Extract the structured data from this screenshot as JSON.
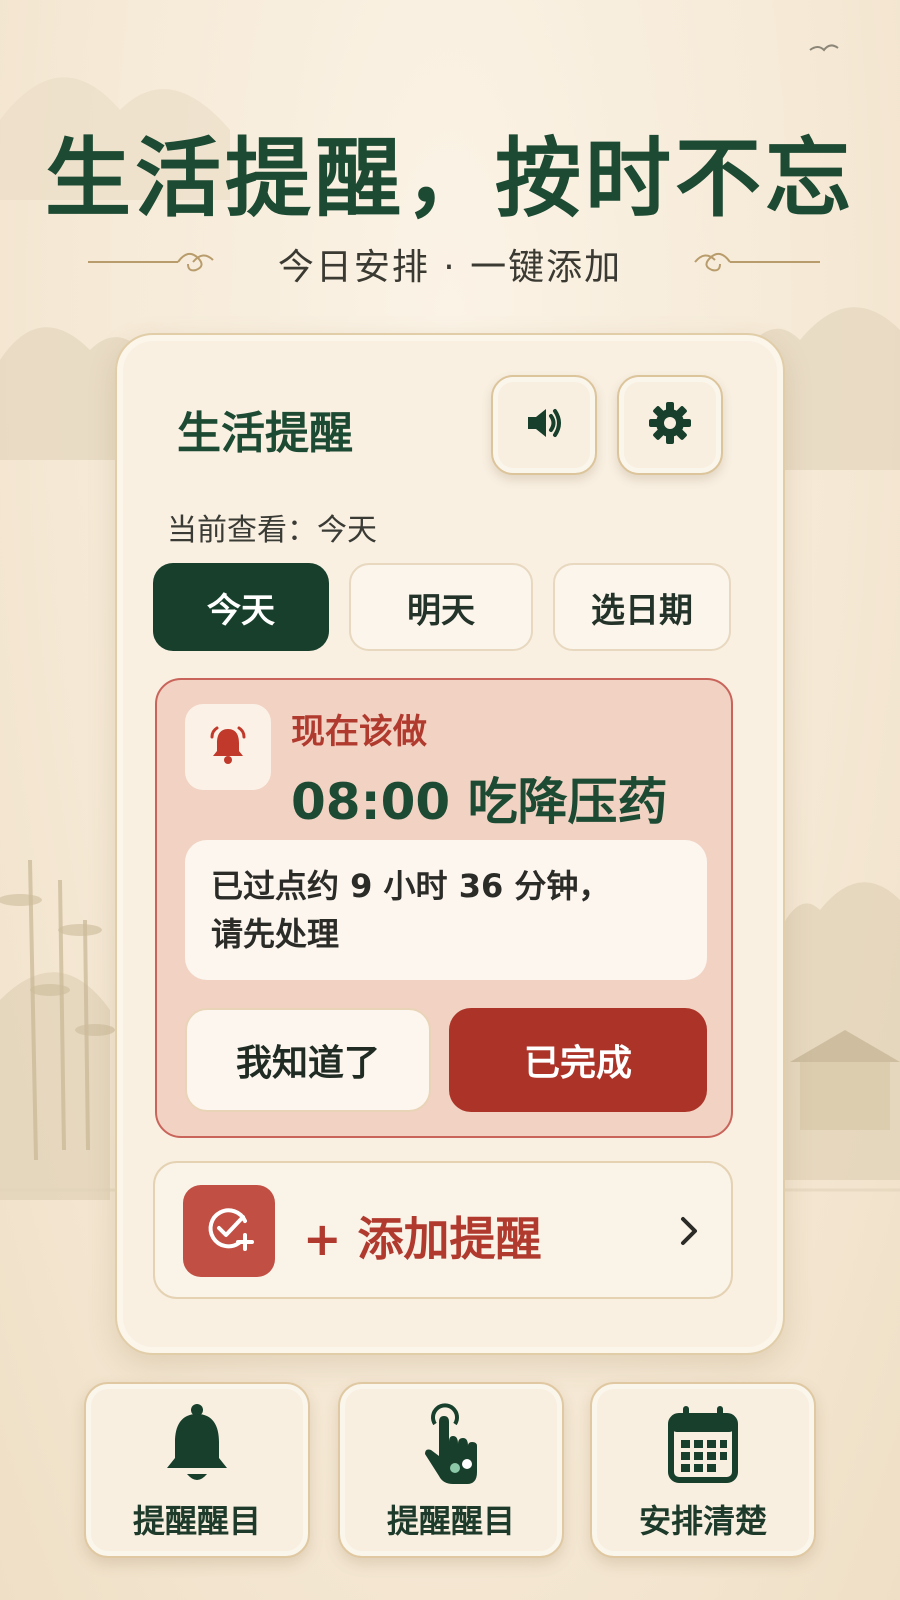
{
  "headline": "生活提醒，按时不忘",
  "subline": "今日安排 · 一键添加",
  "card": {
    "title": "生活提醒",
    "sound_icon": "speaker-icon",
    "settings_icon": "gear-icon",
    "viewing_text": "当前查看：今天",
    "tabs": [
      {
        "label": "今天",
        "active": true
      },
      {
        "label": "明天",
        "active": false
      },
      {
        "label": "选日期",
        "active": false
      }
    ],
    "alert": {
      "icon": "bell-icon",
      "label": "现在该做",
      "task": "08:00 吃降压药",
      "note_line1": "已过点约 9 小时 36 分钟，",
      "note_line2": "请先处理",
      "ack_label": "我知道了",
      "done_label": "已完成"
    },
    "add": {
      "icon": "check-plus-icon",
      "label": "+ 添加提醒",
      "chevron_icon": "chevron-right-icon"
    }
  },
  "features": [
    {
      "icon": "bell-icon",
      "label": "提醒醒目"
    },
    {
      "icon": "tap-hand-icon",
      "label": "提醒醒目"
    },
    {
      "icon": "calendar-icon",
      "label": "安排清楚"
    }
  ],
  "colors": {
    "primary_green": "#1d4a33",
    "alert_red": "#ac3328",
    "background": "#f6ead7"
  }
}
